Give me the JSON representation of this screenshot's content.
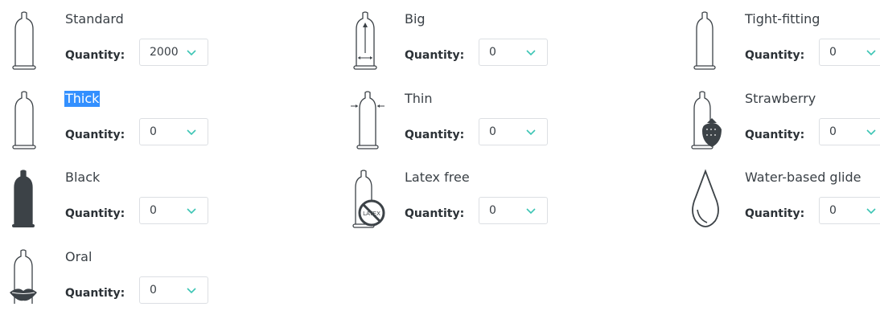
{
  "quantity_label": "Quantity:",
  "accent_color": "#3cc5b4",
  "products": [
    {
      "name": "Standard",
      "quantity": "2000",
      "icon": "standard-condom-icon",
      "selected": false
    },
    {
      "name": "Big",
      "quantity": "0",
      "icon": "big-condom-icon",
      "selected": false
    },
    {
      "name": "Tight-fitting",
      "quantity": "0",
      "icon": "tight-fitting-condom-icon",
      "selected": false
    },
    {
      "name": "Thick",
      "quantity": "0",
      "icon": "thick-condom-icon",
      "selected": true
    },
    {
      "name": "Thin",
      "quantity": "0",
      "icon": "thin-condom-icon",
      "selected": false
    },
    {
      "name": "Strawberry",
      "quantity": "0",
      "icon": "strawberry-condom-icon",
      "selected": false
    },
    {
      "name": "Black",
      "quantity": "0",
      "icon": "black-condom-icon",
      "selected": false
    },
    {
      "name": "Latex free",
      "quantity": "0",
      "icon": "latex-free-condom-icon",
      "selected": false
    },
    {
      "name": "Water-based glide",
      "quantity": "0",
      "icon": "water-drop-icon",
      "selected": false
    },
    {
      "name": "Oral",
      "quantity": "0",
      "icon": "oral-condom-icon",
      "selected": false
    }
  ],
  "latex_badge_text": "LATEX"
}
